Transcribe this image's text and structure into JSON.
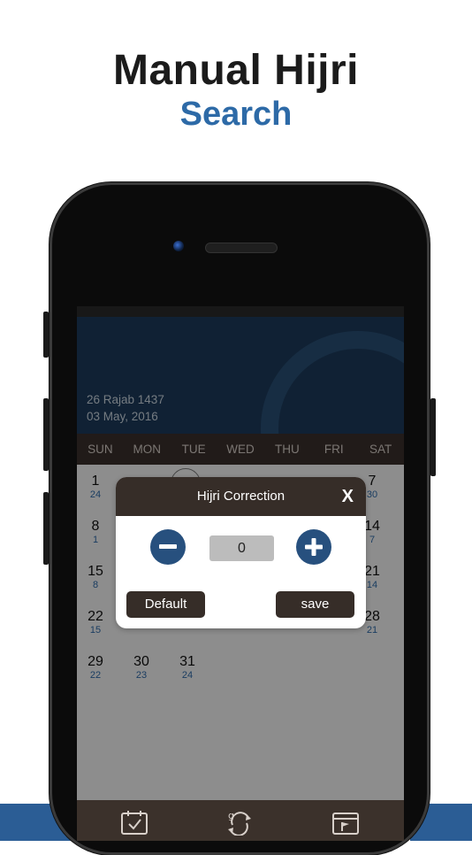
{
  "promo": {
    "title": "Manual Hijri",
    "subtitle": "Search"
  },
  "header": {
    "hijri_date": "26 Rajab 1437",
    "gregorian_date": "03 May, 2016"
  },
  "weekdays": [
    "SUN",
    "MON",
    "TUE",
    "WED",
    "THU",
    "FRI",
    "SAT"
  ],
  "calendar": {
    "visible_cells": [
      {
        "g": "1",
        "h": "24"
      },
      {
        "g": "7",
        "h": "30"
      },
      {
        "g": "8",
        "h": "1"
      },
      {
        "g": "14",
        "h": "7"
      },
      {
        "g": "15",
        "h": "8"
      },
      {
        "g": "21",
        "h": "14"
      },
      {
        "g": "22",
        "h": "15"
      },
      {
        "g": "28",
        "h": "21"
      },
      {
        "g": "29",
        "h": "22"
      },
      {
        "g": "30",
        "h": "23"
      },
      {
        "g": "31",
        "h": "24"
      }
    ]
  },
  "dialog": {
    "title": "Hijri Correction",
    "close_label": "X",
    "value": "0",
    "default_label": "Default",
    "save_label": "save"
  },
  "tabs": [
    "calendar-check-icon",
    "date-convert-icon",
    "calendar-flag-icon"
  ],
  "colors": {
    "accent": "#2d6aa7",
    "dialog_header": "#362d28",
    "round_button": "#27507e"
  }
}
